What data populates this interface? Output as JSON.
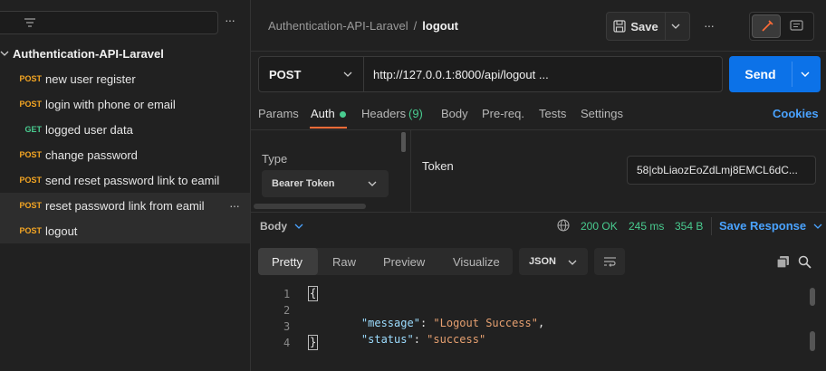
{
  "sidebar": {
    "more_label": "···",
    "collection": "Authentication-API-Laravel",
    "items": [
      {
        "method": "POST",
        "name": "new user register"
      },
      {
        "method": "POST",
        "name": "login with phone or email"
      },
      {
        "method": "GET",
        "name": "logged user data"
      },
      {
        "method": "POST",
        "name": "change password"
      },
      {
        "method": "POST",
        "name": "send reset password link to eamil"
      },
      {
        "method": "POST",
        "name": "reset password link from eamil"
      },
      {
        "method": "POST",
        "name": "logout"
      }
    ]
  },
  "header": {
    "breadcrumb_collection": "Authentication-API-Laravel",
    "breadcrumb_sep": "/",
    "request_name": "logout",
    "save_label": "Save",
    "more_label": "···"
  },
  "request": {
    "method": "POST",
    "url": "http://127.0.0.1:8000/api/logout ...",
    "send_label": "Send"
  },
  "tabs": {
    "params": "Params",
    "auth": "Auth",
    "headers": "Headers",
    "headers_count": "(9)",
    "body": "Body",
    "prereq": "Pre-req.",
    "tests": "Tests",
    "settings": "Settings",
    "cookies": "Cookies"
  },
  "auth": {
    "type_label": "Type",
    "type_value": "Bearer Token",
    "token_label": "Token",
    "token_value": "58|cbLiaozEoZdLmj8EMCL6dC..."
  },
  "response": {
    "body_label": "Body",
    "status": "200 OK",
    "time": "245 ms",
    "size": "354 B",
    "save_response": "Save Response",
    "view_tabs": [
      "Pretty",
      "Raw",
      "Preview",
      "Visualize"
    ],
    "format": "JSON",
    "line_numbers": [
      "1",
      "2",
      "3",
      "4"
    ],
    "lines": [
      {
        "open": "{"
      },
      {
        "key": "\"message\"",
        "colon": ": ",
        "value": "\"Logout Success\"",
        "comma": ","
      },
      {
        "key": "\"status\"",
        "colon": ": ",
        "value": "\"success\"",
        "comma": ""
      },
      {
        "close": "}"
      }
    ]
  },
  "colors": {
    "accent_blue": "#0c72e8",
    "post": "#f5a623",
    "get": "#49cc90",
    "status_ok": "#49cc90",
    "json_key": "#9cdcfe",
    "json_string": "#e6a070",
    "link_blue": "#4aa3ff",
    "auth_underline": "#ff6c37"
  }
}
